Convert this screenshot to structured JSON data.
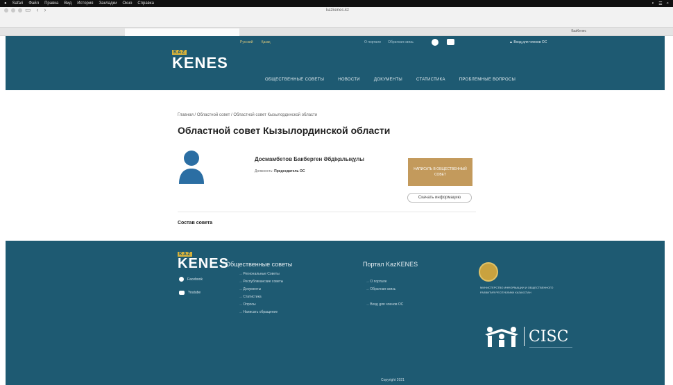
{
  "menubar": {
    "items": [
      "Safari",
      "Файл",
      "Правка",
      "Вид",
      "История",
      "Закладки",
      "Окно",
      "Справка"
    ]
  },
  "browser": {
    "url": "kazkenes.kz",
    "tab_right": "КазКенес"
  },
  "header": {
    "logo_small": "KAZ",
    "logo": "KENES",
    "langs": [
      "Русский",
      "Қазақ"
    ],
    "links": [
      "О портале",
      "Обратная связь"
    ],
    "login": "Вход для членов ОС",
    "nav": [
      "ОБЩЕСТВЕННЫЕ СОВЕТЫ",
      "НОВОСТИ",
      "ДОКУМЕНТЫ",
      "СТАТИСТИКА",
      "ПРОБЛЕМНЫЕ ВОПРОСЫ"
    ]
  },
  "main": {
    "breadcrumb": "Главная / Областной совет / Областной совет Кызылординской области",
    "title": "Областной совет Кызылординской области",
    "person": {
      "name": "Досмамбетов Бакберген Әбдіқалықұлы",
      "position_label": "Должность:",
      "position_value": "Председатель ОС"
    },
    "write_button": "НАПИСАТЬ В ОБЩЕСТВЕННЫЙ СОВЕТ",
    "download_button": "Скачать информацию",
    "council_label": "Состав совета"
  },
  "footer": {
    "logo_small": "KAZ",
    "logo": "KENES",
    "social": [
      {
        "label": "Facebook",
        "icon": "facebook-icon"
      },
      {
        "label": "Youtube",
        "icon": "youtube-icon"
      }
    ],
    "col1_title": "Общественные советы",
    "col1_items": [
      "→ Региональные Советы",
      "→ Республиканские советы",
      "→ Документы",
      "→ Статистика",
      "→ Опросы",
      "→ Написать обращение"
    ],
    "col2_title": "Портал KazKENES",
    "col2_items": [
      "→ О портале",
      "→ Обратная связь",
      "→ Вход для членов ОС"
    ],
    "ministry": "МИНИСТЕРСТВО ИНФОРМАЦИИ И ОБЩЕСТВЕННОГО РАЗВИТИЯ РЕСПУБЛИКИ КАЗАХСТАН",
    "cisc": "CISC",
    "copyright": "Copyright 2021"
  },
  "colors": {
    "brand_teal": "#1e5a72",
    "gold": "#c39a5c",
    "avatar_blue": "#2b6ea3"
  }
}
